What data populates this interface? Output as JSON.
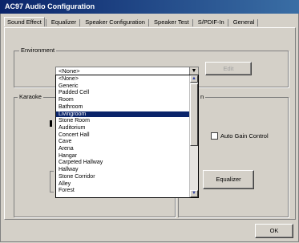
{
  "window": {
    "title": "AC97 Audio Configuration"
  },
  "tabs": [
    "Sound Effect",
    "Equalizer",
    "Speaker Configuration",
    "Speaker Test",
    "S/PDIF-In",
    "General"
  ],
  "environment": {
    "group_label": "Environment",
    "selected": "<None>",
    "edit_label": "Edit",
    "options": [
      "<None>",
      "Generic",
      "Padded Cell",
      "Room",
      "Bathroom",
      "Livingroom",
      "Stone Room",
      "Auditorium",
      "Concert Hall",
      "Cave",
      "Arena",
      "Hangar",
      "Carpeted Hallway",
      "Hallway",
      "Stone Corridor",
      "Alley",
      "Forest"
    ],
    "highlighted": "Livingroom"
  },
  "karaoke": {
    "group_label": "Karaoke"
  },
  "other_group": {
    "label_tail": "n"
  },
  "auto_gain": {
    "label": "Auto Gain Control",
    "checked": false
  },
  "equalizer_button": "Equalizer",
  "ok_button": "OK"
}
